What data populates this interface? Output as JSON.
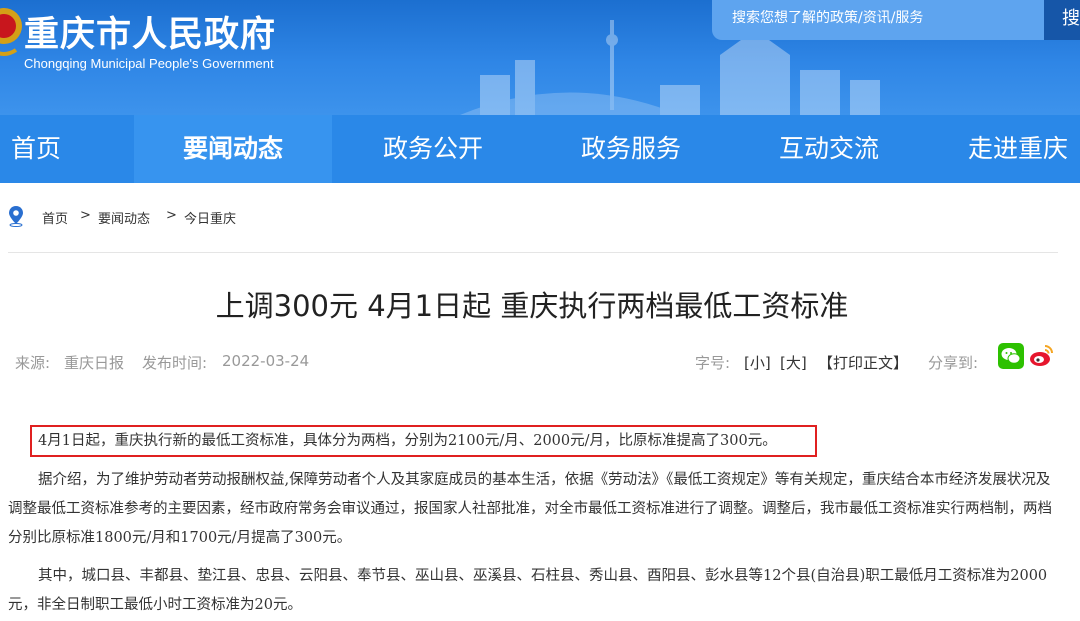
{
  "header": {
    "title": "重庆市人民政府",
    "subtitle": "Chongqing Municipal People's Government",
    "search_placeholder": "搜索您想了解的政策/资讯/服务",
    "search_button": "搜索"
  },
  "nav": {
    "items": [
      {
        "label": "首页"
      },
      {
        "label": "要闻动态"
      },
      {
        "label": "政务公开"
      },
      {
        "label": "政务服务"
      },
      {
        "label": "互动交流"
      },
      {
        "label": "走进重庆"
      }
    ],
    "active_index": 1
  },
  "breadcrumb": [
    "首页",
    "要闻动态",
    "今日重庆"
  ],
  "breadcrumb_separator": ">",
  "article": {
    "title": "上调300元 4月1日起 重庆执行两档最低工资标准",
    "source_label": "来源:",
    "source": "重庆日报",
    "date_label": "发布时间:",
    "date": "2022-03-24",
    "font_size_label": "字号:",
    "font_small": "[小]",
    "font_large": "[大]",
    "print": "【打印正文】",
    "share_label": "分享到:",
    "share_icons": [
      "wechat-icon",
      "weibo-icon"
    ],
    "paragraphs": [
      "4月1日起，重庆执行新的最低工资标准，具体分为两档，分别为2100元/月、2000元/月，比原标准提高了300元。",
      "据介绍，为了维护劳动者劳动报酬权益,保障劳动者个人及其家庭成员的基本生活，依据《劳动法》《最低工资规定》等有关规定，重庆结合本市经济发展状况及调整最低工资标准参考的主要因素，经市政府常务会审议通过，报国家人社部批准，对全市最低工资标准进行了调整。调整后，我市最低工资标准实行两档制，两档分别比原标准1800元/月和1700元/月提高了300元。",
      "其中，城口县、丰都县、垫江县、忠县、云阳县、奉节县、巫山县、巫溪县、石柱县、秀山县、酉阳县、彭水县等12个县(自治县)职工最低月工资标准为2000元，非全日制职工最低小时工资标准为20元。"
    ]
  },
  "colors": {
    "header_blue": "#2a88e8",
    "nav_active": "#3794ef",
    "highlight_border": "#e02020",
    "wechat_green": "#2dc100",
    "weibo_red": "#e6162d"
  }
}
